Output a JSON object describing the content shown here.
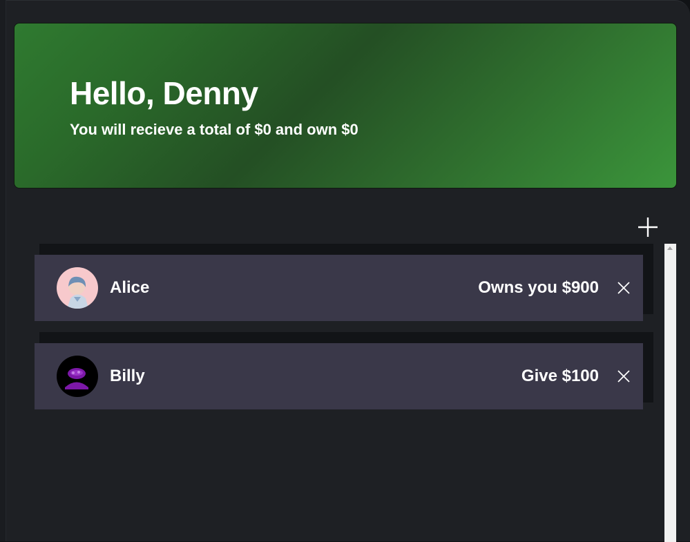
{
  "hero": {
    "title": "Hello, Denny",
    "subtitle": "You will recieve a total of $0 and own $0"
  },
  "actions": {
    "add_icon": "plus-icon"
  },
  "contacts": [
    {
      "name": "Alice",
      "status": "Owns you $900",
      "avatar": "avatar-alice",
      "close_icon": "close-icon"
    },
    {
      "name": "Billy",
      "status": "Give $100",
      "avatar": "avatar-billy",
      "close_icon": "close-icon"
    }
  ],
  "colors": {
    "background": "#1e2024",
    "hero_green": "#2f7a30",
    "card": "#3a3849",
    "text": "#ffffff"
  }
}
